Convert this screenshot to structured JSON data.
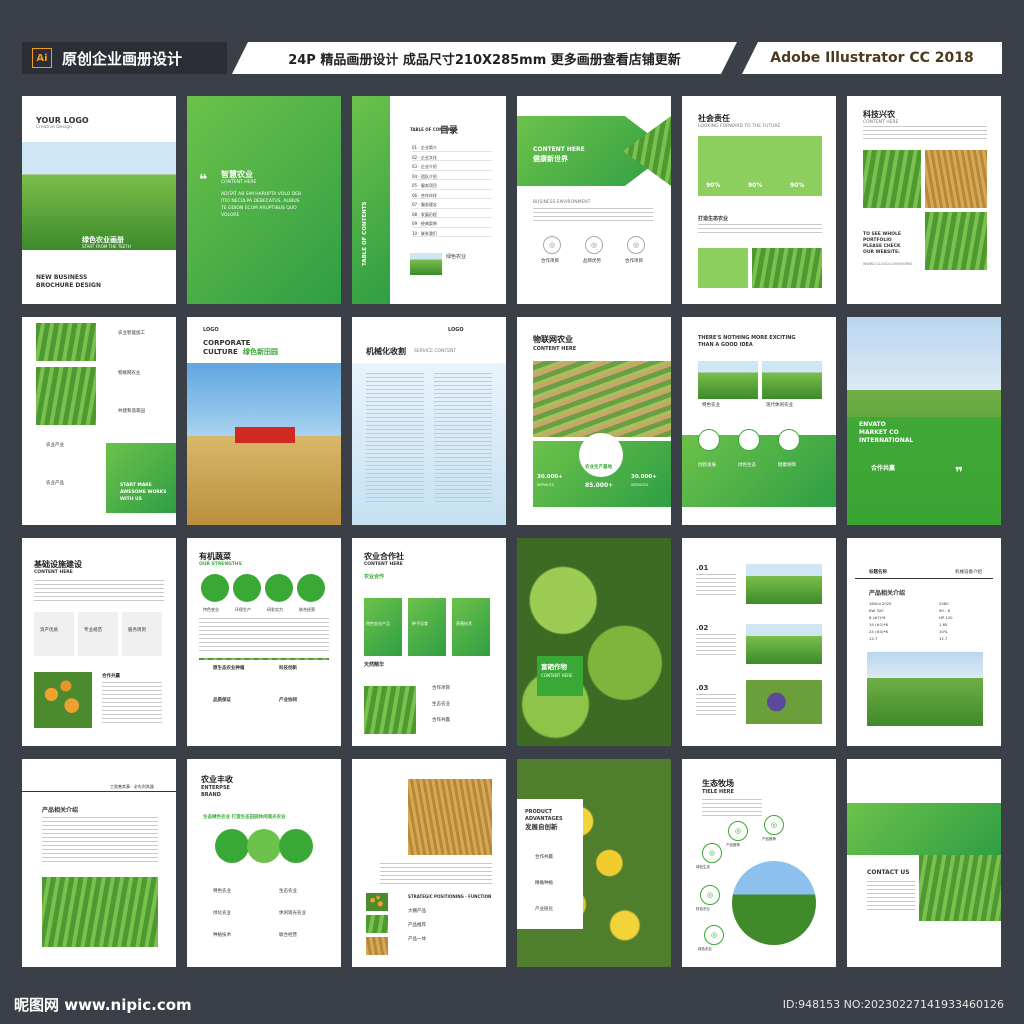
{
  "header": {
    "ai_badge": "Ai",
    "left_title": "原创企业画册设计",
    "middle_title": "24P 精品画册设计  成品尺寸210X285mm  更多画册查看店铺更新",
    "right_title": "Adobe Illustrator CC 2018"
  },
  "pages": {
    "p1": {
      "logo": "YOUR LOGO",
      "sub": "Creative Design",
      "title": "绿色农业画册",
      "tag": "START FROM THE TEETH",
      "caption1": "NEW BUSINESS",
      "caption2": "BROCHURE DESIGN"
    },
    "p2": {
      "title": "智慧农业",
      "sub": "CONTENT HERE",
      "body1": "ADITAT AB SIM HARUPTA VOLO DEB",
      "body2": "ITIO NECULPA DEBECATUS, ALIBUS",
      "body3": "TE ODION ECUM ARUPTIBUS QUO",
      "body4": "VOLORE"
    },
    "p3": {
      "side": "TABLE OF CONTENTS",
      "head_en": "TABLE OF CONTENTS",
      "head": "目录",
      "items": [
        "01 · 企业简介",
        "02 · 企业文化",
        "03 · 企业介绍",
        "04 · 团队介绍",
        "05 · 服务项目",
        "06 · 合作伙伴",
        "07 · 服务理念",
        "08 · 发展历程",
        "09 · 经典案例",
        "10 · 联系我们"
      ],
      "caption": "绿色农业"
    },
    "p4": {
      "title1": "CONTENT HERE",
      "title2": "健康新世界",
      "caption": "BUSINESS ENVIRONMENT",
      "icons": [
        "合作项目",
        "品牌优势",
        "合作项目"
      ]
    },
    "p5": {
      "title": "社会责任",
      "sub": "LOOKING FORWARD TO THE FUTURE",
      "stat1": "90%",
      "stat2": "90%",
      "stat3": "90%",
      "section": "打造生态农业"
    },
    "p6": {
      "title": "科技兴农",
      "sub": "CONTENT HERE",
      "cta1": "TO SEE WHOLE",
      "cta2": "PORTFOLIO",
      "cta3": "PLEASE CHECK",
      "cta4": "OUR WEBSITE:",
      "url": "WWW.CCLOUD.COM/WORKS"
    },
    "p7": {
      "items": [
        "农业智能加工",
        "物联网农业",
        "农业产业",
        "共建和谐家园",
        "农业产品"
      ],
      "cta1": "START MAKE",
      "cta2": "AWESOME WORKS",
      "cta3": "WITH US"
    },
    "p8": {
      "logo": "LOGO",
      "title1": "CORPORATE",
      "title2": "CULTURE",
      "title3": "绿色新田园"
    },
    "p9": {
      "logo": "LOGO",
      "title": "机械化收割",
      "sub": "SERVICE CONTENT"
    },
    "p10": {
      "title": "物联网农业",
      "sub": "CONTENT HERE",
      "stat1": "30.000+",
      "stat2": "85.000+",
      "stat3": "30.000+",
      "center": "农业生产基地",
      "stat_label": "SERVICES"
    },
    "p11": {
      "title1": "THERE'S NOTHING MORE EXCITING",
      "title2": "THAN A GOOD IDEA",
      "cap1": "特色农业",
      "cap2": "现代休闲农业",
      "icons": [
        "创新发展",
        "绿色生态",
        "健康保障"
      ]
    },
    "p12": {
      "title1": "ENVATO",
      "title2": "MARKET CO",
      "title3": "INTERNATIONAL",
      "sub": "合作共赢"
    },
    "p13": {
      "title": "基础设施建设",
      "sub": "CONTENT HERE",
      "boxes": [
        "资产优质",
        "专业规范",
        "服务周到"
      ],
      "caption": "合作共赢"
    },
    "p14": {
      "title": "有机蔬菜",
      "sub": "OUR STRENGTHS",
      "icons": [
        "特色农业",
        "环保生产",
        "研发实力",
        "联合经营"
      ],
      "items": [
        "原生态农业种植",
        "科技创新",
        "品质保证",
        "产业协同"
      ]
    },
    "p15": {
      "title": "农业合作社",
      "sub": "CONTENT HERE",
      "section": "农业合作",
      "cards": [
        "特色农业产品",
        "种子培育",
        "养殖技术"
      ],
      "section2": "天然精华",
      "list": [
        "合作项目",
        "生态农业",
        "合作共赢"
      ]
    },
    "p16": {
      "title": "富硒作物",
      "sub": "CONTENT HERE"
    },
    "p17": {
      "n1": ".01",
      "n2": ".02",
      "n3": ".03"
    },
    "p18": {
      "header": "机械设备介绍",
      "logo": "标题名称",
      "title": "产品相关介绍",
      "specs": [
        "1600×2025",
        "KW 320",
        "6 (#7)*6",
        "19 (#1)*8",
        "24 (#4)*6",
        "12.7"
      ],
      "specs2": [
        "2580",
        "90 - 6",
        "HP 120",
        "1.65",
        "10%",
        "12.7"
      ]
    },
    "p19": {
      "header": "工欲善其事 · 必先利其器",
      "title": "产品相关介绍"
    },
    "p20": {
      "title": "农业丰收",
      "sub1": "ENTERPSE",
      "sub2": "BRAND",
      "tagline": "生态绿色农业 打造生态田园休闲观光农业",
      "items": [
        "特色农业",
        "生态农业",
        "绿化农业",
        "休闲观光农业",
        "种植技术",
        "联合经营"
      ]
    },
    "p21": {
      "caption": "STRATEGIC POSITIONING · FUNCTION",
      "list": [
        "大棚产品",
        "产品推荐",
        "产品一体"
      ]
    },
    "p22": {
      "title1": "PRODUCT",
      "title2": "ADVANTAGES",
      "title3": "发展自创新",
      "items": [
        "合作共赢",
        "精确种植",
        "产业链化"
      ]
    },
    "p23": {
      "title": "生态牧场",
      "sub": "TIELE HERE",
      "icons": [
        "绿色生态",
        "产品推荐",
        "产品推荐",
        "特色农业",
        "绿色农业"
      ]
    },
    "p24": {
      "contact": "CONTACT US"
    }
  },
  "footer": {
    "watermark": "昵图网 www.nipic.com",
    "id": "ID:948153 NO:20230227141933460126"
  },
  "colors": {
    "brand_green": "#3aa835",
    "light_green": "#8ccf5f",
    "background": "#3b3f47"
  }
}
